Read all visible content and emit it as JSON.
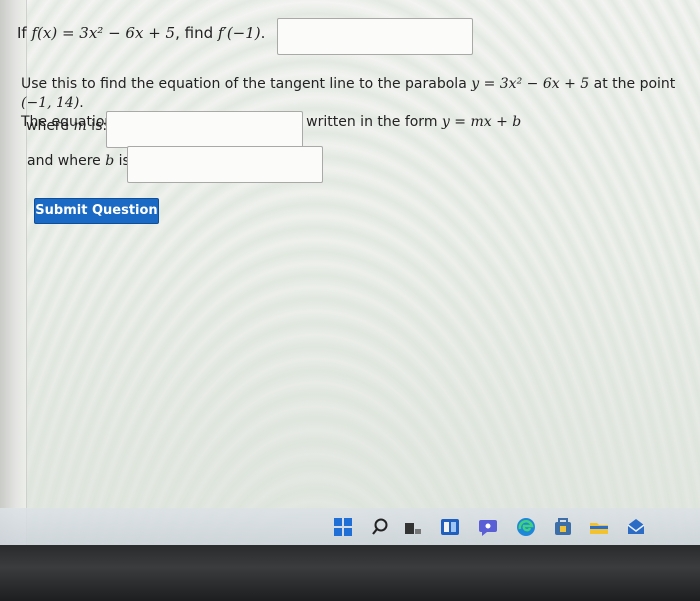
{
  "question": {
    "part1": {
      "prefix": "If ",
      "function": "f(x) = 3x² − 6x + 5",
      "middle": ", find ",
      "target": "f′(−1)",
      "suffix": "."
    },
    "paragraph": {
      "line1_text": "Use this to find the equation of the tangent line to the parabola ",
      "line1_math": "y = 3x² − 6x + 5",
      "line1_mid": " at the point ",
      "line1_point": "(−1, 14)",
      "line1_end": ".",
      "line2_text": "The equation of this tangent line can be written in the form ",
      "line2_math": "y = mx + b"
    },
    "m_label_prefix": "where ",
    "m_label_var": "m",
    "m_label_suffix": " is:",
    "b_label_prefix": "and where ",
    "b_label_var": "b",
    "b_label_suffix": " is:",
    "answer_fprime": "",
    "answer_m": "",
    "answer_b": ""
  },
  "submit_label": "Submit Question",
  "taskbar": {
    "icons": [
      "windows-start-icon",
      "search-icon",
      "task-view-icon",
      "widgets-icon",
      "chat-icon",
      "edge-browser-icon",
      "store-icon",
      "file-explorer-icon",
      "mail-icon"
    ]
  },
  "colors": {
    "submit_bg": "#1a69c4",
    "page_bg": "#f4f4f2",
    "bezel": "#2a2b2d"
  }
}
